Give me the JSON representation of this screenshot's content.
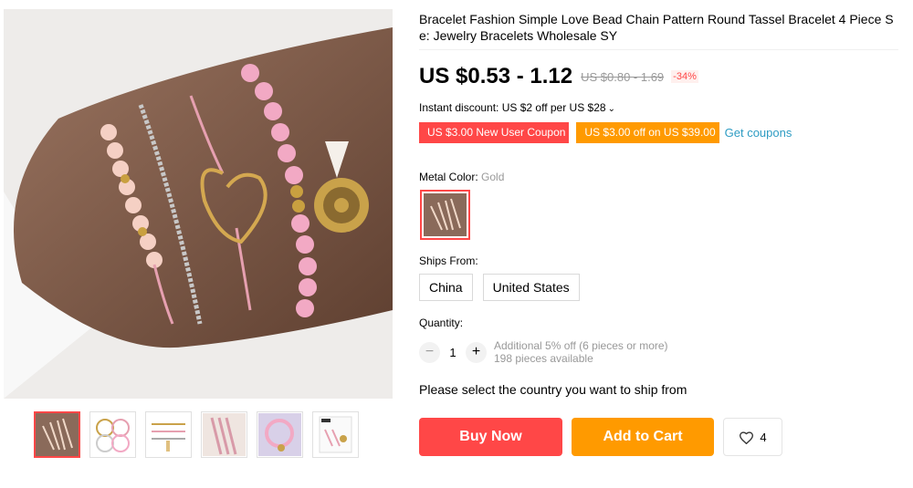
{
  "product": {
    "title": "Bracelet Fashion Simple Love Bead Chain Pattern Round Tassel Bracelet 4 Piece Se: Jewelry Bracelets Wholesale SY"
  },
  "price": {
    "current": "US $0.53 - 1.12",
    "original": "US $0.80 - 1.69",
    "discount": "-34%"
  },
  "instant_discount": {
    "text": "Instant discount: US $2 off per US $28",
    "chevron": "⌄"
  },
  "coupons": {
    "new_user": "US $3.00 New User Coupon",
    "store": "US $3.00 off on US $39.00",
    "link": "Get coupons"
  },
  "metal_color": {
    "label": "Metal Color:",
    "value": "Gold"
  },
  "ships_from": {
    "label": "Ships From:",
    "options": [
      "China",
      "United States"
    ]
  },
  "quantity": {
    "label": "Quantity:",
    "minus": "−",
    "value": "1",
    "plus": "+",
    "bulk_note": "Additional 5% off (6 pieces or more)",
    "available": "198 pieces available"
  },
  "ship_note": "Please select the country you want to ship from",
  "actions": {
    "buy_now": "Buy Now",
    "add_to_cart": "Add to Cart",
    "wishlist_count": "4"
  },
  "icons": {
    "wishlist": "heart-icon",
    "chevron": "chevron-down-icon"
  },
  "colors": {
    "accent_red": "#ff4747",
    "accent_orange": "#ff9a00",
    "link_blue": "#2e9cc3"
  }
}
